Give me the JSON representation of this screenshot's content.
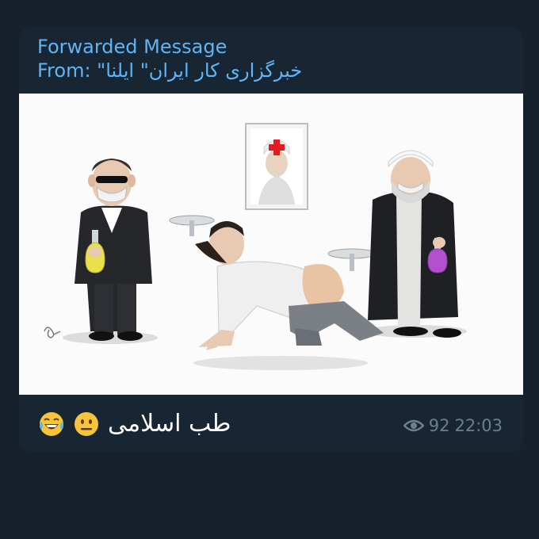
{
  "forward": {
    "title": "Forwarded Message",
    "from_line": "From: \"خبرگزاری کار ایران\" ایلنا"
  },
  "media": {
    "type": "cartoon-image",
    "poster_cross_color": "#e11b22"
  },
  "caption": {
    "text": "طب اسلامی",
    "emojis": [
      "grinning-face-with-tears-icon",
      "neutral-face-icon"
    ]
  },
  "meta": {
    "views": "92",
    "time": "22:03",
    "views_icon": "eye-icon"
  },
  "colors": {
    "app_background": "#17212b",
    "bubble_background": "#182533",
    "accent": "#5eb5f7",
    "meta_text": "#6d7f8f"
  }
}
